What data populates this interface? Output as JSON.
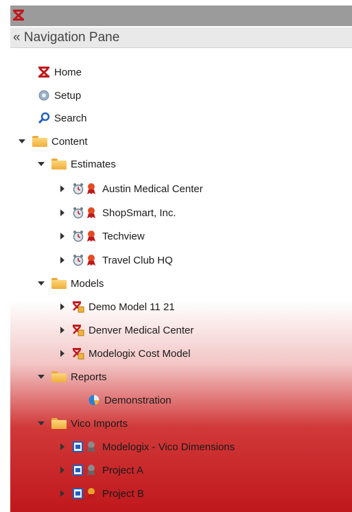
{
  "nav_header": {
    "label": "« Navigation Pane"
  },
  "items": {
    "home": "Home",
    "setup": "Setup",
    "search": "Search",
    "content": "Content",
    "estimates": "Estimates",
    "estimate_1": "Austin Medical Center",
    "estimate_2": "ShopSmart, Inc.",
    "estimate_3": "Techview",
    "estimate_4": "Travel Club HQ",
    "models": "Models",
    "model_1": "Demo Model 11 21",
    "model_2": "Denver Medical Center",
    "model_3": "Modelogix Cost Model",
    "reports": "Reports",
    "report_1": "Demonstration",
    "vico": "Vico Imports",
    "vico_1": "Modelogix - Vico Dimensions",
    "vico_2": "Project A",
    "vico_3": "Project B"
  },
  "colors": {
    "titlebar": "#9b9b9b",
    "accent_red": "#c0181c",
    "folder": "#f0ae3a"
  }
}
